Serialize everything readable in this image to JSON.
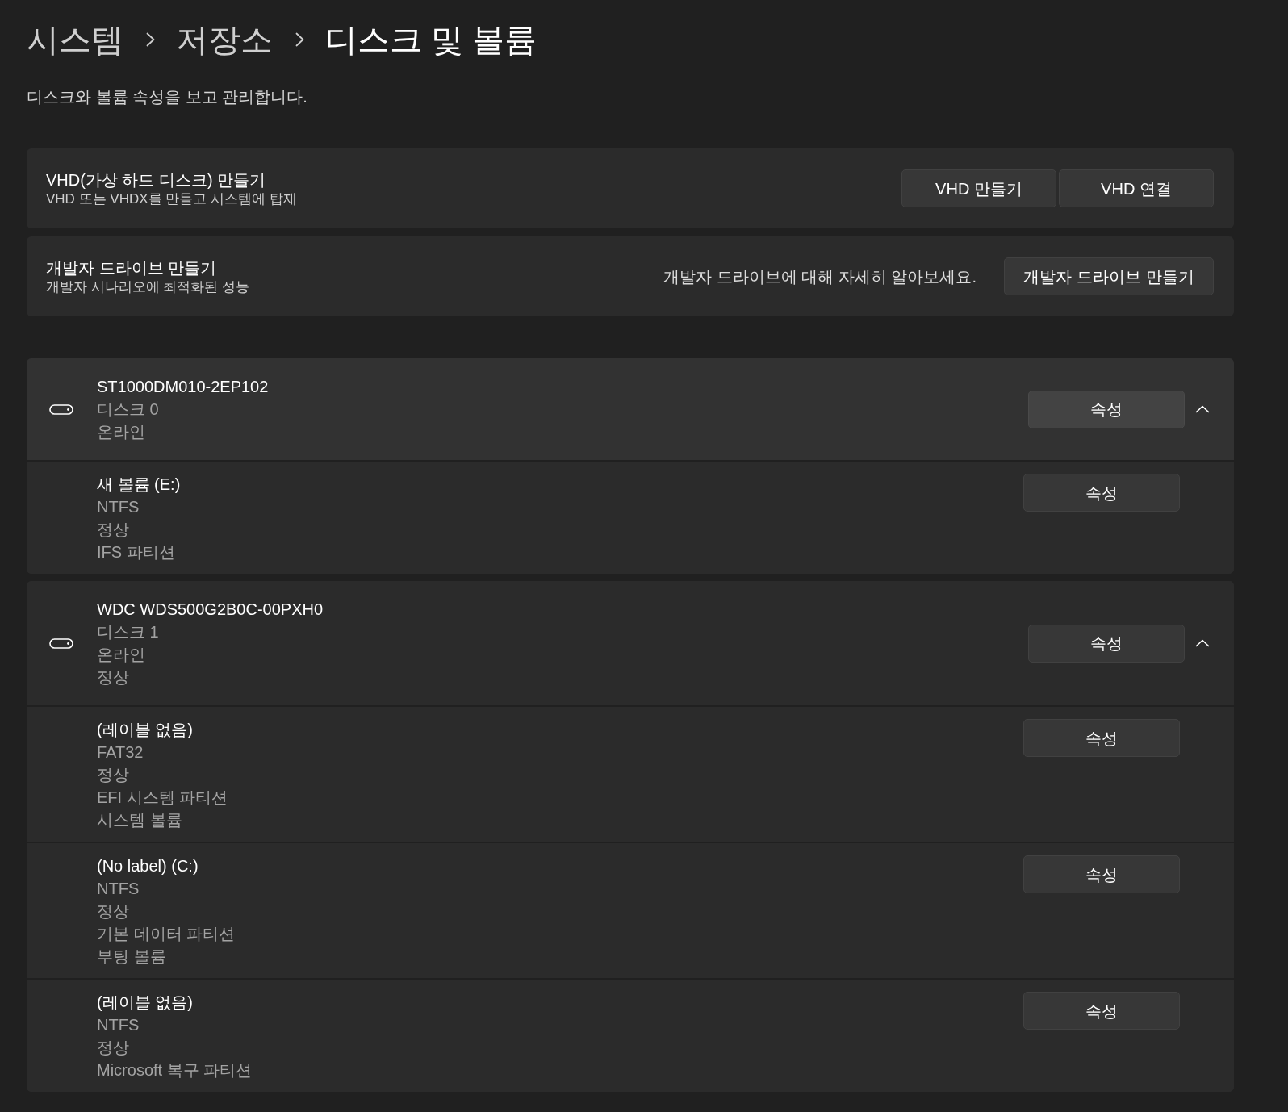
{
  "breadcrumb": [
    {
      "label": "시스템",
      "current": false
    },
    {
      "label": "저장소",
      "current": false
    },
    {
      "label": "디스크 및 볼륨",
      "current": true
    }
  ],
  "description": "디스크와 볼륨 속성을 보고 관리합니다.",
  "actions": [
    {
      "title": "VHD(가상 하드 디스크) 만들기",
      "subtitle": "VHD 또는 VHDX를 만들고 시스템에 탑재",
      "buttons": [
        "VHD 만들기",
        "VHD 연결"
      ]
    },
    {
      "title": "개발자 드라이브 만들기",
      "subtitle": "개발자 시나리오에 최적화된 성능",
      "link": "개발자 드라이브에 대해 자세히 알아보세요.",
      "buttons": [
        "개발자 드라이브 만들기"
      ]
    }
  ],
  "disks": [
    {
      "name": "ST1000DM010-2EP102",
      "details": [
        "디스크 0",
        "온라인"
      ],
      "button": "속성",
      "expanded": true,
      "highlighted": true,
      "volumes": [
        {
          "name": "새 볼륨 (E:)",
          "details": [
            "NTFS",
            "정상",
            "IFS 파티션"
          ],
          "button": "속성"
        }
      ]
    },
    {
      "name": "WDC WDS500G2B0C-00PXH0",
      "details": [
        "디스크 1",
        "온라인",
        "정상"
      ],
      "button": "속성",
      "expanded": true,
      "highlighted": false,
      "volumes": [
        {
          "name": "(레이블 없음)",
          "details": [
            "FAT32",
            "정상",
            "EFI 시스템 파티션",
            "시스템 볼륨"
          ],
          "button": "속성"
        },
        {
          "name": "(No label) (C:)",
          "details": [
            "NTFS",
            "정상",
            "기본 데이터 파티션",
            "부팅 볼륨"
          ],
          "button": "속성"
        },
        {
          "name": "(레이블 없음)",
          "details": [
            "NTFS",
            "정상",
            "Microsoft 복구 파티션"
          ],
          "button": "속성"
        }
      ]
    }
  ]
}
